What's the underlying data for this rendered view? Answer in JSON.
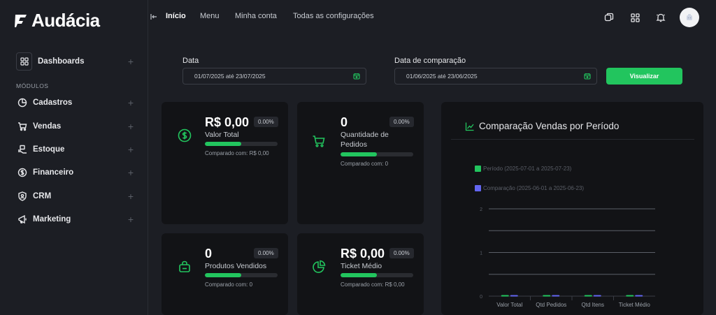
{
  "brand": {
    "name": "Audácia"
  },
  "sidebar": {
    "dashboards": "Dashboards",
    "section_label": "MÓDULOS",
    "items": [
      {
        "label": "Cadastros",
        "icon": "pie-chart-icon"
      },
      {
        "label": "Vendas",
        "icon": "cart-icon"
      },
      {
        "label": "Estoque",
        "icon": "box-hand-icon"
      },
      {
        "label": "Financeiro",
        "icon": "dollar-circle-icon"
      },
      {
        "label": "CRM",
        "icon": "crm-icon"
      },
      {
        "label": "Marketing",
        "icon": "megaphone-icon"
      }
    ],
    "plus": "+"
  },
  "topbar": {
    "nav": [
      "Início",
      "Menu",
      "Minha conta",
      "Todas as configurações"
    ],
    "active": "Início"
  },
  "filters": {
    "date_label": "Data",
    "date_value": "01/07/2025 até 23/07/2025",
    "compare_label": "Data de comparação",
    "compare_value": "01/06/2025 até 23/06/2025",
    "submit": "Visualizar"
  },
  "kpis": [
    {
      "value": "R$ 0,00",
      "badge": "0.00%",
      "label": "Valor Total",
      "compare": "Comparado com: R$ 0,00",
      "progress": 0.5
    },
    {
      "value": "0",
      "badge": "0.00%",
      "label": "Quantidade de Pedidos",
      "compare": "Comparado com: 0",
      "progress": 0.5
    },
    {
      "value": "0",
      "badge": "0.00%",
      "label": "Produtos Vendidos",
      "compare": "Comparado com: 0",
      "progress": 0.5
    },
    {
      "value": "R$ 0,00",
      "badge": "0.00%",
      "label": "Ticket Médio",
      "compare": "Comparado com: R$ 0,00",
      "progress": 0.5
    }
  ],
  "colors": {
    "accent": "#22c55e",
    "series1": "#22c55e",
    "series2": "#6366f1"
  },
  "chart_data": {
    "type": "bar",
    "title": "Comparação Vendas por Período",
    "categories": [
      "Valor Total",
      "Qtd Pedidos",
      "Qtd Itens",
      "Ticket Médio"
    ],
    "series": [
      {
        "name": "Período (2025-07-01 a 2025-07-23)",
        "values": [
          0,
          0,
          0,
          0
        ]
      },
      {
        "name": "Comparação (2025-06-01 a 2025-06-23)",
        "values": [
          0,
          0,
          0,
          0
        ]
      }
    ],
    "yticks": [
      "0",
      "1",
      "2"
    ],
    "ylim": [
      0,
      2
    ],
    "grid": true,
    "legend": "top-left"
  }
}
